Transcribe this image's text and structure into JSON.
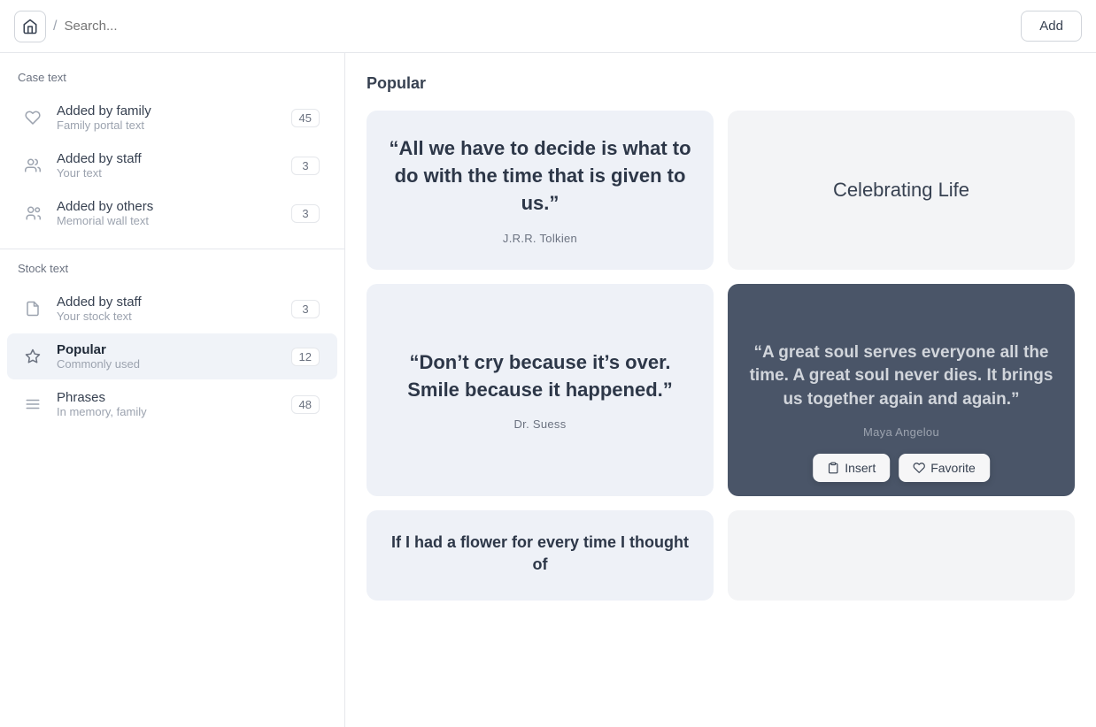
{
  "header": {
    "search_placeholder": "Search...",
    "add_label": "Add",
    "breadcrumb_sep": "/"
  },
  "sidebar": {
    "case_text_label": "Case text",
    "stock_text_label": "Stock text",
    "items": [
      {
        "id": "added-by-family",
        "title": "Added by family",
        "subtitle": "Family portal text",
        "badge": "45",
        "icon": "heart",
        "active": false,
        "section": "case"
      },
      {
        "id": "added-by-staff-case",
        "title": "Added by staff",
        "subtitle": "Your text",
        "badge": "3",
        "icon": "users",
        "active": false,
        "section": "case"
      },
      {
        "id": "added-by-others",
        "title": "Added by others",
        "subtitle": "Memorial wall text",
        "badge": "3",
        "icon": "users-alt",
        "active": false,
        "section": "case"
      },
      {
        "id": "added-by-staff-stock",
        "title": "Added by staff",
        "subtitle": "Your stock text",
        "badge": "3",
        "icon": "file",
        "active": false,
        "section": "stock"
      },
      {
        "id": "popular",
        "title": "Popular",
        "subtitle": "Commonly used",
        "badge": "12",
        "icon": "star",
        "active": true,
        "section": "stock"
      },
      {
        "id": "phrases",
        "title": "Phrases",
        "subtitle": "In memory, family",
        "badge": "48",
        "icon": "menu",
        "active": false,
        "section": "stock"
      }
    ]
  },
  "content": {
    "title": "Popular",
    "cards": [
      {
        "id": "tolkien",
        "type": "quote-light",
        "quote": "“All we have to decide is what to do with the time that is given to us.”",
        "author": "J.R.R. Tolkien"
      },
      {
        "id": "celebrating-life",
        "type": "title-only",
        "title": "Celebrating Life"
      },
      {
        "id": "suess",
        "type": "quote-light",
        "quote": "“Don’t cry because it’s over. Smile because it happened.”",
        "author": "Dr. Suess"
      },
      {
        "id": "maya",
        "type": "quote-dark",
        "quote": "“A great soul serves everyone all the time. A great soul never dies. It brings us together again and again.”",
        "author": "Maya Angelou",
        "has_overlay": true,
        "overlay_buttons": [
          {
            "id": "insert",
            "label": "Insert",
            "icon": "clipboard"
          },
          {
            "id": "favorite",
            "label": "Favorite",
            "icon": "heart"
          }
        ]
      },
      {
        "id": "flower",
        "type": "quote-partial",
        "quote": "If I had a flower for every time I thought of"
      }
    ]
  }
}
